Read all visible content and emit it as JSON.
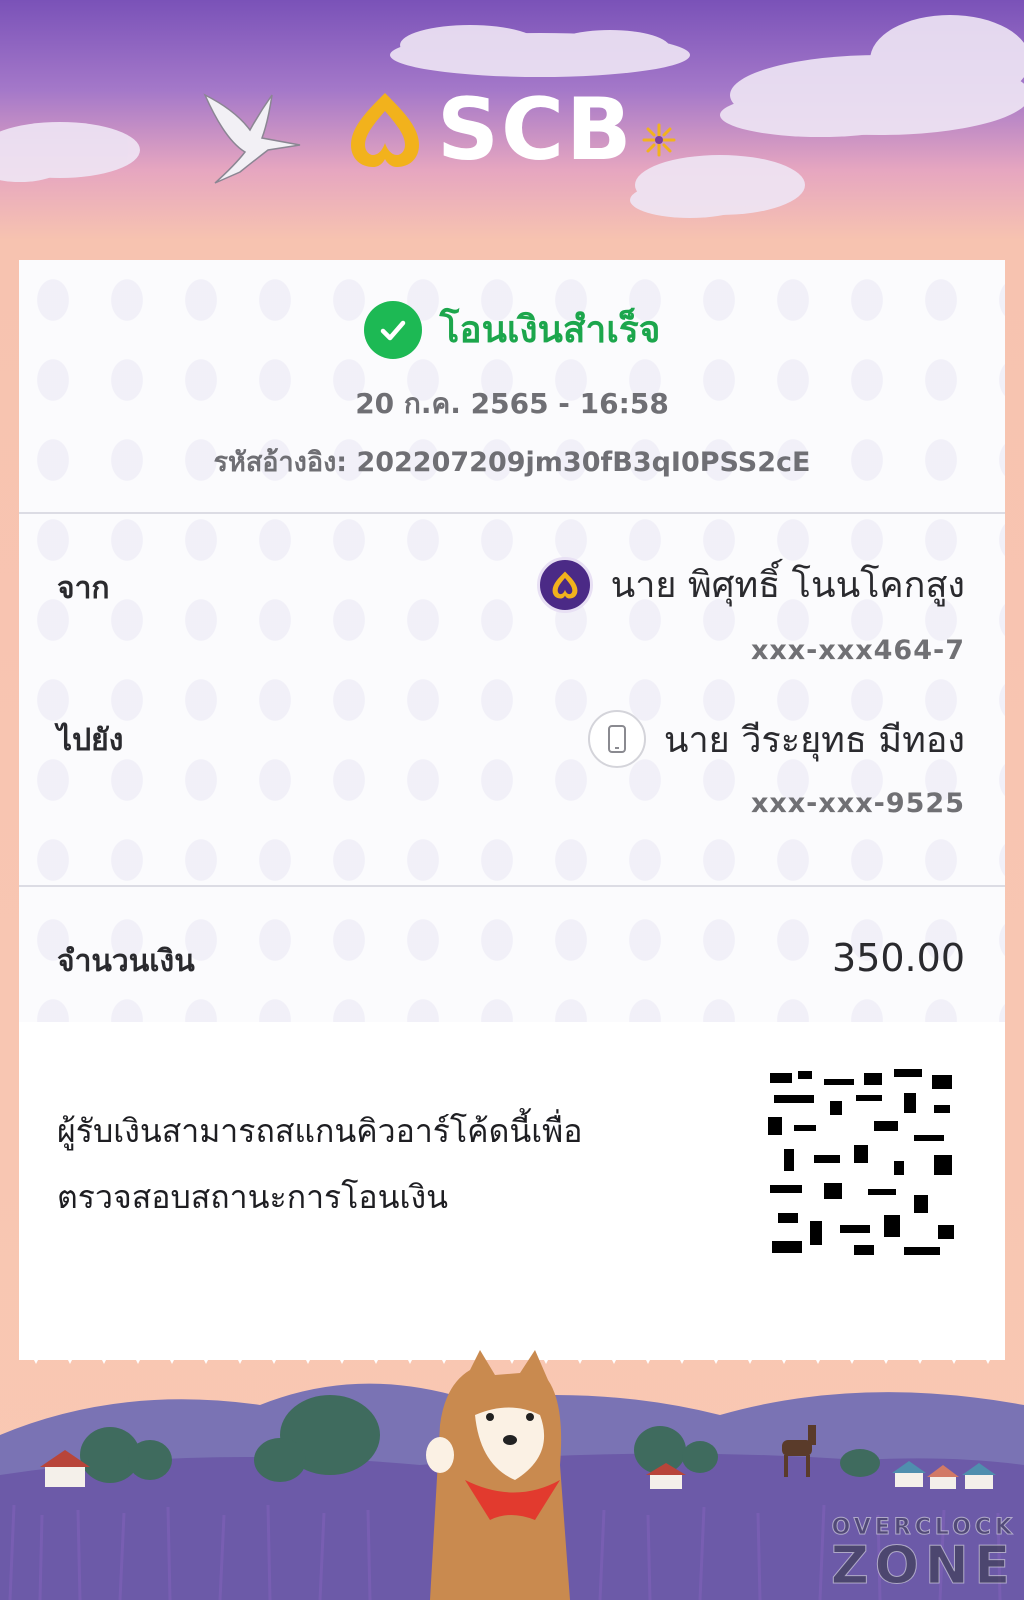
{
  "header": {
    "brand": "SCB"
  },
  "receipt": {
    "status": "โอนเงินสำเร็จ",
    "datetime": "20 ก.ค. 2565 - 16:58",
    "reference": "รหัสอ้างอิง: 202207209jm30fB3qI0PSS2cE",
    "from": {
      "label": "จาก",
      "name": "นาย พิศุทธิ์ โนนโคกสูง",
      "account": "xxx-xxx464-7"
    },
    "to": {
      "label": "ไปยัง",
      "name": "นาย วีระยุทธ มีทอง",
      "account": "xxx-xxx-9525"
    },
    "amount_label": "จำนวนเงิน",
    "amount": "350.00",
    "qr_note_line1": "ผู้รับเงินสามารถสแกนคิวอาร์โค้ดนี้เพื่อ",
    "qr_note_line2": "ตรวจสอบสถานะการโอนเงิน"
  },
  "watermark": {
    "top": "OVERCLOCK",
    "bottom": "ZONE"
  },
  "colors": {
    "success": "#1db954",
    "brand_purple": "#4b2a86",
    "brand_gold": "#f2b21c"
  }
}
